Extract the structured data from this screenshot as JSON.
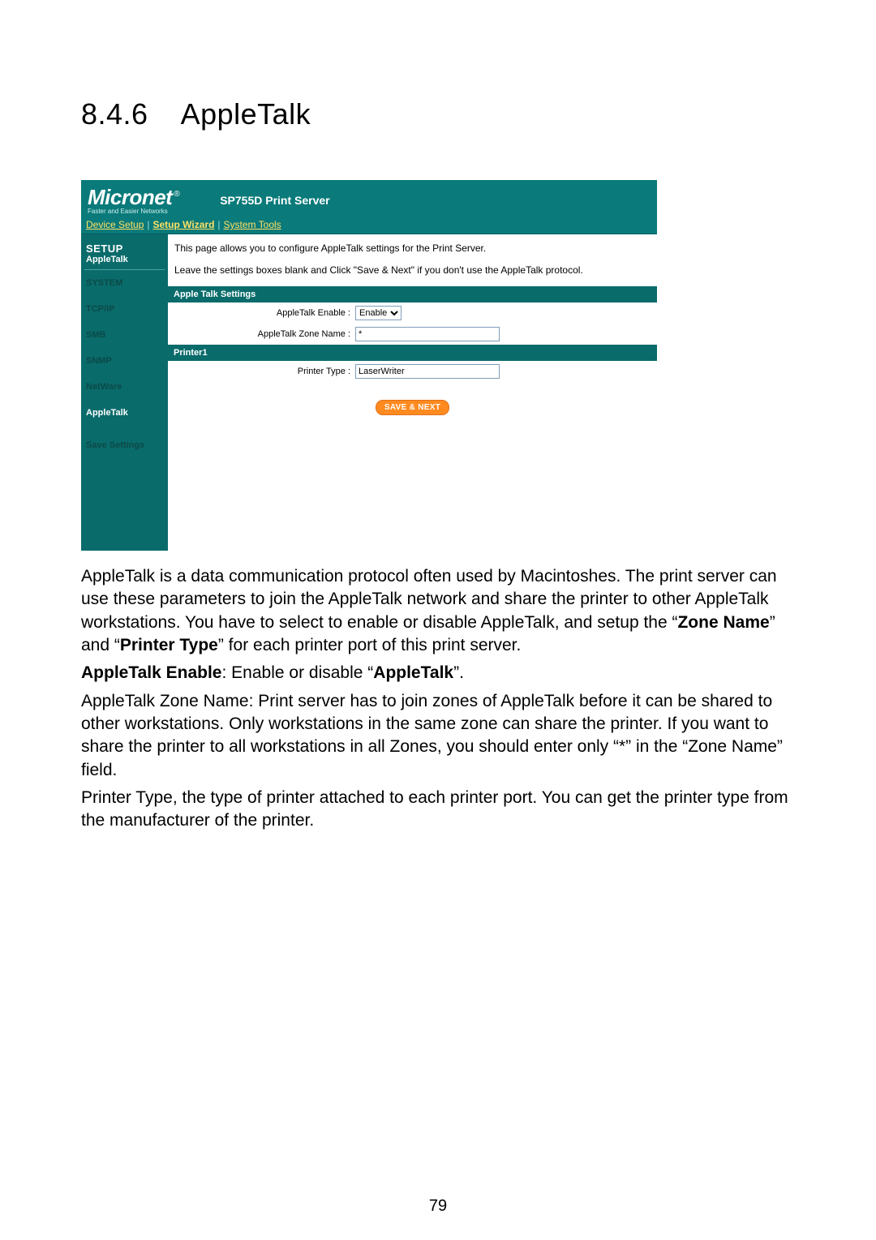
{
  "heading": {
    "number": "8.4.6",
    "title": "AppleTalk"
  },
  "ui": {
    "brand": {
      "name": "Micronet",
      "reg": "®",
      "tagline": "Faster and Easier Networks"
    },
    "product": "SP755D Print Server",
    "topnav": {
      "device_setup": "Device Setup",
      "setup_wizard": "Setup Wizard",
      "system_tools": "System Tools"
    },
    "sidebar": {
      "setup": "SETUP",
      "subtitle": "AppleTalk",
      "items": [
        {
          "label": "SYSTEM"
        },
        {
          "label": "TCP/IP"
        },
        {
          "label": "SMB"
        },
        {
          "label": "SNMP"
        },
        {
          "label": "NetWare"
        },
        {
          "label": "AppleTalk"
        },
        {
          "label": "Save Settings"
        }
      ]
    },
    "content": {
      "intro1": "This page allows you to configure AppleTalk settings for the Print Server.",
      "intro2": "Leave the settings boxes blank and Click \"Save & Next\" if you don't use the AppleTalk protocol.",
      "section1": "Apple Talk Settings",
      "row_enable_label": "AppleTalk Enable :",
      "row_enable_value": "Enable",
      "row_zone_label": "AppleTalk Zone Name :",
      "row_zone_value": "*",
      "section2": "Printer1",
      "row_ptype_label": "Printer Type :",
      "row_ptype_value": "LaserWriter",
      "save_next": "SAVE & NEXT"
    }
  },
  "body": {
    "p1a": "AppleTalk is a data communication protocol often used by Macintoshes. The print server can use these parameters to join the AppleTalk network and share the printer to other AppleTalk workstations. You have to select to enable or disable AppleTalk, and setup the “",
    "p1b_bold": "Zone Name",
    "p1c": "” and “",
    "p1d_bold": "Printer Type",
    "p1e": "” for each printer port of this print server.",
    "p2a_bold": "AppleTalk Enable",
    "p2b": ": Enable or disable “",
    "p2c_bold": "AppleTalk",
    "p2d": "”.",
    "p3": "AppleTalk Zone Name: Print server has to join zones of AppleTalk before it can be shared to other workstations. Only workstations in the same zone can share the printer. If you want to share the printer to all workstations in all Zones, you should enter only “*” in the “Zone Name” field.",
    "p4": "Printer Type, the type of printer attached to each printer port. You can get the printer type from the manufacturer of the printer."
  },
  "page_number": "79"
}
